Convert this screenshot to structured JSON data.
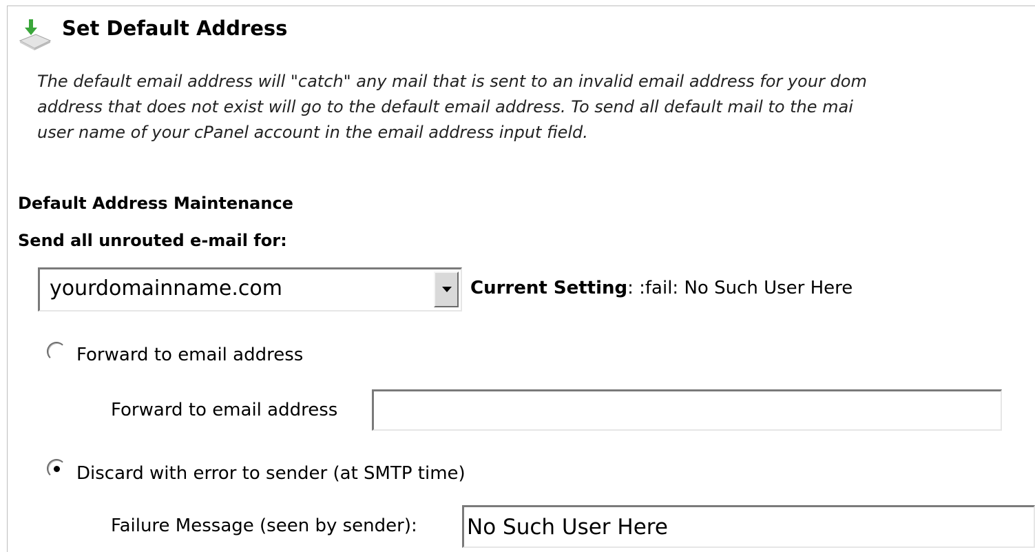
{
  "colors": {
    "icon_arrow": "#3aa63a",
    "border_dark": "#7a7a7a",
    "border_light": "#e6e6e6"
  },
  "header": {
    "icon": "download-arrow-icon",
    "title": "Set Default Address"
  },
  "description": {
    "lines": [
      "The default email address will \"catch\" any mail that is sent to an invalid email address for your dom",
      "address that does not exist will go to the default email address. To send all default mail to the mai",
      "user name of your cPanel account in the email address input field."
    ]
  },
  "maintenance": {
    "heading": "Default Address Maintenance",
    "send_label": "Send all unrouted e-mail for:",
    "domain_select": {
      "selected": "yourdomainname.com"
    },
    "current_setting": {
      "label": "Current Setting",
      "value": ": :fail: No Such User Here"
    }
  },
  "options": {
    "forward": {
      "radio_label": "Forward to email address",
      "field_label": "Forward to email address",
      "value": "",
      "checked": false
    },
    "discard": {
      "radio_label": "Discard with error to sender (at SMTP time)",
      "field_label": "Failure Message (seen by sender):",
      "value": "No Such User Here",
      "checked": true
    }
  }
}
